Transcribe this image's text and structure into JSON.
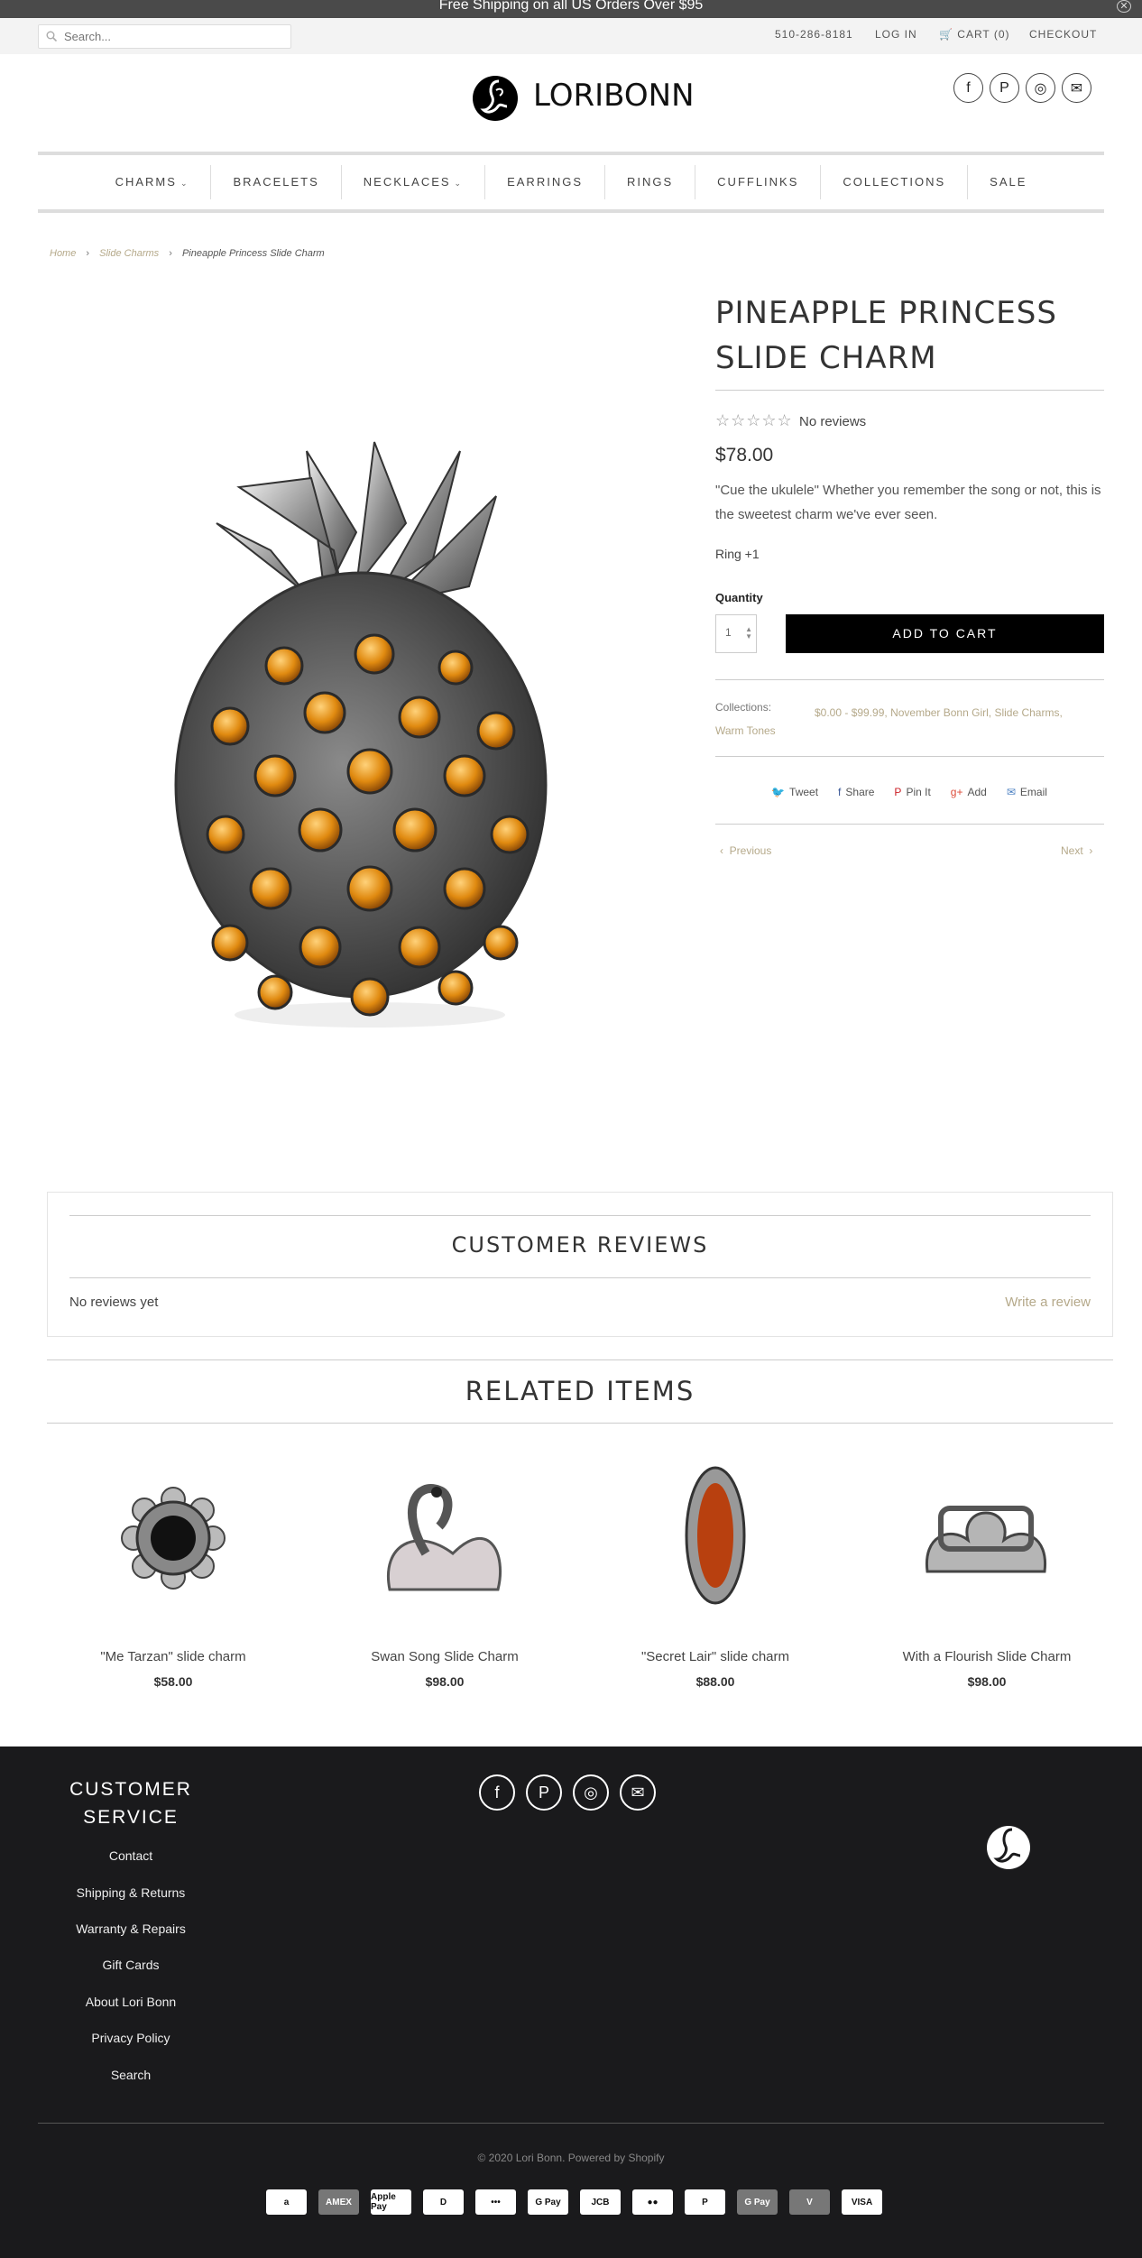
{
  "announcement": {
    "text": "Free Shipping on all US Orders Over $95",
    "close": "✕"
  },
  "topbar": {
    "search_placeholder": "Search...",
    "phone": "510-286-8181",
    "login": "LOG IN",
    "cart": "CART (0)",
    "checkout": "CHECKOUT"
  },
  "brand": {
    "logo_text": "LORIBONN"
  },
  "social": {
    "facebook": "f",
    "pinterest": "P",
    "instagram": "◎",
    "email": "✉"
  },
  "nav": {
    "items": [
      {
        "label": "CHARMS",
        "dropdown": "⌄"
      },
      {
        "label": "BRACELETS"
      },
      {
        "label": "NECKLACES",
        "dropdown": "⌄"
      },
      {
        "label": "EARRINGS"
      },
      {
        "label": "RINGS"
      },
      {
        "label": "CUFFLINKS"
      },
      {
        "label": "COLLECTIONS"
      },
      {
        "label": "SALE"
      }
    ]
  },
  "breadcrumb": {
    "home": "Home",
    "category": "Slide Charms",
    "current": "Pineapple Princess Slide Charm",
    "sep": "›"
  },
  "product": {
    "title": "PINEAPPLE PRINCESS SLIDE CHARM",
    "stars": "☆☆☆☆☆",
    "rating_text": "No reviews",
    "price": "$78.00",
    "description": "\"Cue the ukulele\" Whether you remember the song or not, this is the sweetest charm we've ever seen.",
    "variant": "Ring +1",
    "quantity_label": "Quantity",
    "quantity_value": "1",
    "add_to_cart": "ADD TO CART",
    "collections_label": "Collections:",
    "collections_line1": "$0.00 - $99.99, November Bonn Girl, Slide Charms,",
    "collections_line2": "Warm Tones",
    "share": {
      "tweet": "Tweet",
      "share": "Share",
      "pin": "Pin It",
      "add": "Add",
      "email": "Email"
    },
    "previous": "Previous",
    "next": "Next"
  },
  "reviews": {
    "title": "CUSTOMER REVIEWS",
    "empty": "No reviews yet",
    "write": "Write a review"
  },
  "related": {
    "title": "RELATED ITEMS",
    "items": [
      {
        "name": "\"Me Tarzan\" slide charm",
        "price": "$58.00"
      },
      {
        "name": "Swan Song Slide Charm",
        "price": "$98.00"
      },
      {
        "name": "\"Secret Lair\" slide charm",
        "price": "$88.00"
      },
      {
        "name": "With a Flourish Slide Charm",
        "price": "$98.00"
      }
    ]
  },
  "footer": {
    "heading": "CUSTOMER SERVICE",
    "links": [
      "Contact",
      "Shipping & Returns",
      "Warranty & Repairs",
      "Gift Cards",
      "About Lori Bonn",
      "Privacy Policy",
      "Search"
    ],
    "copyright": "© 2020 Lori Bonn. Powered by Shopify",
    "payments": [
      "a",
      "AMEX",
      "Apple Pay",
      "D",
      "•••",
      "G Pay",
      "JCB",
      "●●",
      "P",
      "G Pay",
      "V",
      "VISA"
    ]
  },
  "colors": {
    "accent": "#b5a98a",
    "button": "#000000",
    "footer": "#1a1a1c"
  }
}
